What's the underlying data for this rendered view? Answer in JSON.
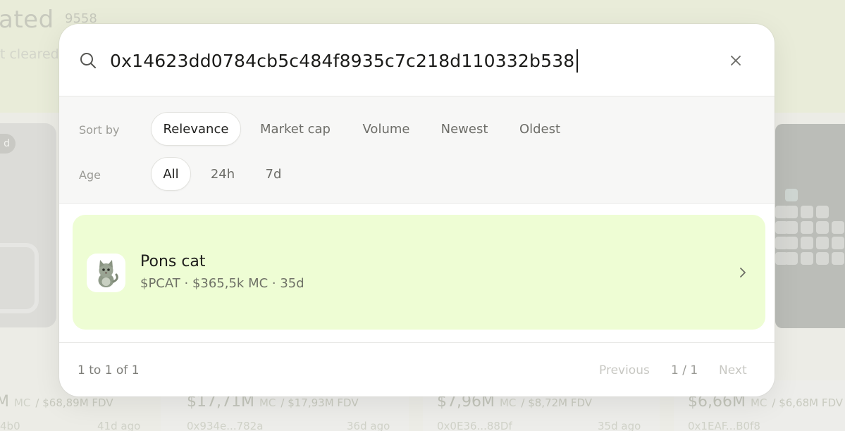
{
  "background": {
    "title_partial": "ated",
    "count_partial": "9558",
    "subtitle_partial": "t cleared",
    "badge_partial": "d",
    "cards": [
      {
        "mc_value": "M",
        "mc_label": "MC",
        "fdv": "/ $68,89M FDV",
        "address": "4b0",
        "age": "41d ago"
      },
      {
        "mc_value": "$17,71M",
        "mc_label": "MC",
        "fdv": "/ $17,93M FDV",
        "address": "0x934e...782a",
        "age": "36d ago"
      },
      {
        "mc_value": "$7,96M",
        "mc_label": "MC",
        "fdv": "/ $8,72M FDV",
        "address": "0x0E36...88Df",
        "age": "35d ago"
      },
      {
        "mc_value": "$6,66M",
        "mc_label": "MC",
        "fdv": "/ $6,68M FDV",
        "address": "0x1EAF...B0f8",
        "age": ""
      }
    ]
  },
  "search": {
    "value": "0x14623dd0784cb5c484f8935c7c218d110332b538",
    "icon": "search-icon",
    "close_icon": "close-icon"
  },
  "filters": {
    "sort_label": "Sort by",
    "sort_options": [
      "Relevance",
      "Market cap",
      "Volume",
      "Newest",
      "Oldest"
    ],
    "sort_selected": "Relevance",
    "age_label": "Age",
    "age_options": [
      "All",
      "24h",
      "7d"
    ],
    "age_selected": "All"
  },
  "results": [
    {
      "name": "Pons cat",
      "meta": "$PCAT · $365,5k MC · 35d",
      "icon": "cat-token-icon",
      "highlight_color": "#eefdd4"
    }
  ],
  "pagination": {
    "range": "1 to 1 of 1",
    "previous": "Previous",
    "page": "1 / 1",
    "next": "Next"
  }
}
